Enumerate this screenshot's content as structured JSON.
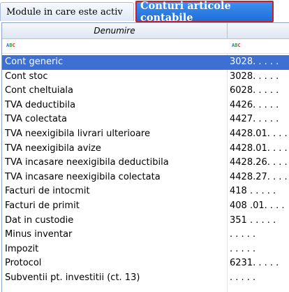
{
  "tabs": {
    "module_label": "Module in care este activ",
    "active_label": "Conturi articole contabile"
  },
  "grid": {
    "column_denumire": "Denumire",
    "filter_icon_text": "ABC",
    "rows": [
      {
        "name": "Cont generic",
        "code": "3028. . . . .",
        "selected": true
      },
      {
        "name": "Cont stoc",
        "code": "3028. . . . .",
        "selected": false
      },
      {
        "name": "Cont cheltuiala",
        "code": "6028. . . . .",
        "selected": false
      },
      {
        "name": "TVA deductibila",
        "code": "4426. . . . .",
        "selected": false
      },
      {
        "name": "TVA colectata",
        "code": "4427. . . . .",
        "selected": false
      },
      {
        "name": "TVA neexigibila livrari ulterioare",
        "code": "4428.01. . . .",
        "selected": false
      },
      {
        "name": "TVA neexigibila avize",
        "code": "4428.01. . . .",
        "selected": false
      },
      {
        "name": "TVA incasare neexigibila deductibila",
        "code": "4428.26. . . .",
        "selected": false
      },
      {
        "name": "TVA incasare neexigibila colectata",
        "code": "4428.27. . . .",
        "selected": false
      },
      {
        "name": "Facturi de intocmit",
        "code": "418 . . . . .",
        "selected": false
      },
      {
        "name": "Facturi de primit",
        "code": "408 .01. . . .",
        "selected": false
      },
      {
        "name": "Dat in custodie",
        "code": "351 . . . . .",
        "selected": false
      },
      {
        "name": "Minus inventar",
        "code": ". . . . .",
        "selected": false
      },
      {
        "name": "Impozit",
        "code": ". . . . .",
        "selected": false
      },
      {
        "name": "Protocol",
        "code": "6231. . . . .",
        "selected": false
      },
      {
        "name": "Subventii pt. investitii (ct. 13)",
        "code": ". . . . .",
        "selected": false
      }
    ]
  }
}
